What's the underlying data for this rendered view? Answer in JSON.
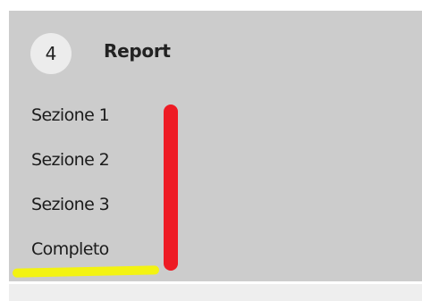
{
  "step": {
    "number": "4",
    "label": "Report"
  },
  "menu": {
    "items": [
      {
        "label": "Sezione 1"
      },
      {
        "label": "Sezione 2"
      },
      {
        "label": "Sezione 3"
      },
      {
        "label": "Completo"
      }
    ]
  },
  "annotations": {
    "red_mark_color": "#ee1b24",
    "yellow_underline_color": "#f3f312"
  },
  "colors": {
    "panel_background": "#cccccc",
    "step_circle_background": "#ececec"
  }
}
